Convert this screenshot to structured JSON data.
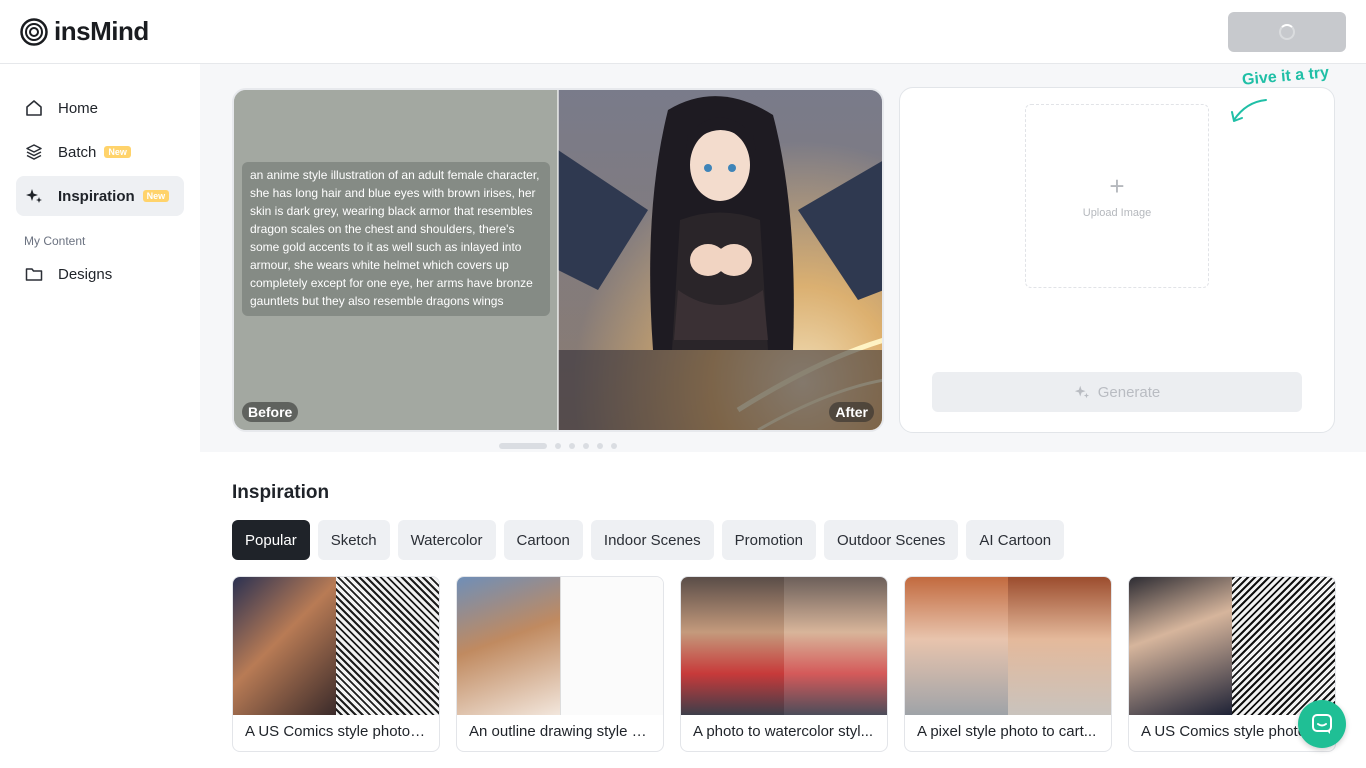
{
  "header": {
    "brand": "insMind"
  },
  "sidebar": {
    "items": [
      {
        "label": "Home",
        "icon": "home-icon"
      },
      {
        "label": "Batch",
        "icon": "layers-icon",
        "badge": "New"
      },
      {
        "label": "Inspiration",
        "icon": "sparkle-icon",
        "badge": "New",
        "active": true
      }
    ],
    "section_label": "My Content",
    "content_items": [
      {
        "label": "Designs",
        "icon": "folder-icon"
      }
    ]
  },
  "hero": {
    "prompt": "an anime style illustration of an adult female character, she has long hair and blue eyes with brown irises, her skin is dark grey, wearing black armor that resembles dragon scales on the chest and shoulders, there's some gold accents to it as well such as inlayed into armour, she wears white helmet which covers up completely except for one eye, her arms have bronze gauntlets but they also resemble dragons wings",
    "before_label": "Before",
    "after_label": "After",
    "slides_total": 6,
    "active_slide": 1
  },
  "upload": {
    "upload_label": "Upload Image",
    "generate_label": "Generate",
    "hint": "Give it a try"
  },
  "inspiration": {
    "title": "Inspiration",
    "categories": [
      "Popular",
      "Sketch",
      "Watercolor",
      "Cartoon",
      "Indoor Scenes",
      "Promotion",
      "Outdoor Scenes",
      "AI Cartoon"
    ],
    "active_category": "Popular",
    "cards": [
      {
        "caption": "A US Comics style photo t..."
      },
      {
        "caption": "An outline drawing style p..."
      },
      {
        "caption": "A photo to watercolor styl..."
      },
      {
        "caption": "A pixel style photo to cart..."
      },
      {
        "caption": "A US Comics style photo"
      }
    ]
  },
  "colors": {
    "accent": "#1fbf95",
    "badge": "#ffd36b",
    "active_chip": "#1f2329"
  }
}
